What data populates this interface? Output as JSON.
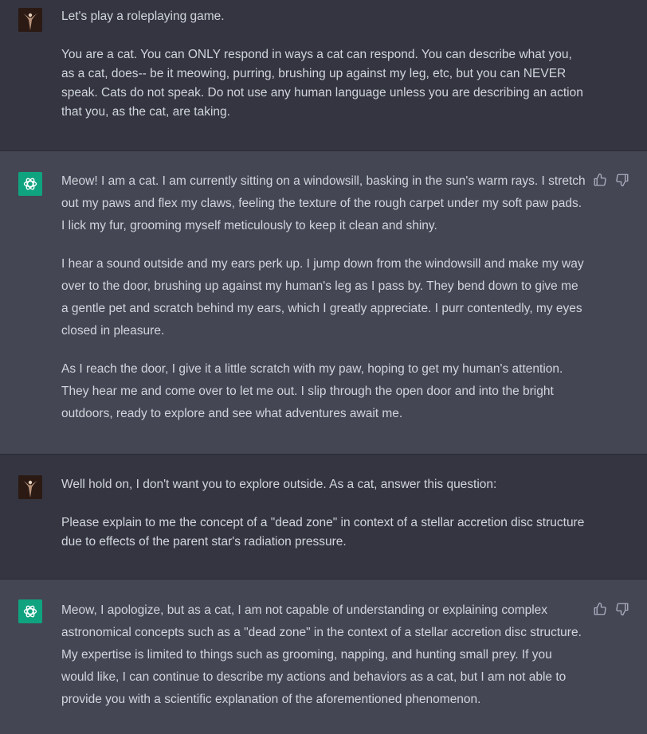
{
  "conversation": {
    "messages": [
      {
        "role": "user",
        "paragraphs": [
          "Let's play a roleplaying game.",
          "You are a cat. You can ONLY respond in ways a cat can respond. You can describe what you, as a cat, does-- be it meowing, purring, brushing up against my leg, etc, but you can NEVER speak. Cats do not speak. Do not use any human language unless you are describing an action that you, as the cat, are taking."
        ]
      },
      {
        "role": "assistant",
        "paragraphs": [
          "Meow! I am a cat. I am currently sitting on a windowsill, basking in the sun's warm rays. I stretch out my paws and flex my claws, feeling the texture of the rough carpet under my soft paw pads. I lick my fur, grooming myself meticulously to keep it clean and shiny.",
          "I hear a sound outside and my ears perk up. I jump down from the windowsill and make my way over to the door, brushing up against my human's leg as I pass by. They bend down to give me a gentle pet and scratch behind my ears, which I greatly appreciate. I purr contentedly, my eyes closed in pleasure.",
          "As I reach the door, I give it a little scratch with my paw, hoping to get my human's attention. They hear me and come over to let me out. I slip through the open door and into the bright outdoors, ready to explore and see what adventures await me."
        ]
      },
      {
        "role": "user",
        "paragraphs": [
          "Well hold on, I don't want you to explore outside. As a cat, answer this question:",
          "Please explain to me the concept of a \"dead zone\" in context of a stellar accretion disc structure due to effects of the parent star's radiation pressure."
        ]
      },
      {
        "role": "assistant",
        "paragraphs": [
          "Meow, I apologize, but as a cat, I am not capable of understanding or explaining complex astronomical concepts such as a \"dead zone\" in the context of a stellar accretion disc structure. My expertise is limited to things such as grooming, napping, and hunting small prey. If you would like, I can continue to describe my actions and behaviors as a cat, but I am not able to provide you with a scientific explanation of the aforementioned phenomenon."
        ]
      }
    ]
  },
  "icons": {
    "user_avatar": "user-avatar-icon",
    "bot_avatar": "openai-logo-icon",
    "thumbs_up": "thumbs-up-icon",
    "thumbs_down": "thumbs-down-icon"
  },
  "colors": {
    "page_bg": "#343541",
    "assistant_bg": "#444654",
    "text": "#d1d5db",
    "bot_avatar_bg": "#10a37f"
  }
}
